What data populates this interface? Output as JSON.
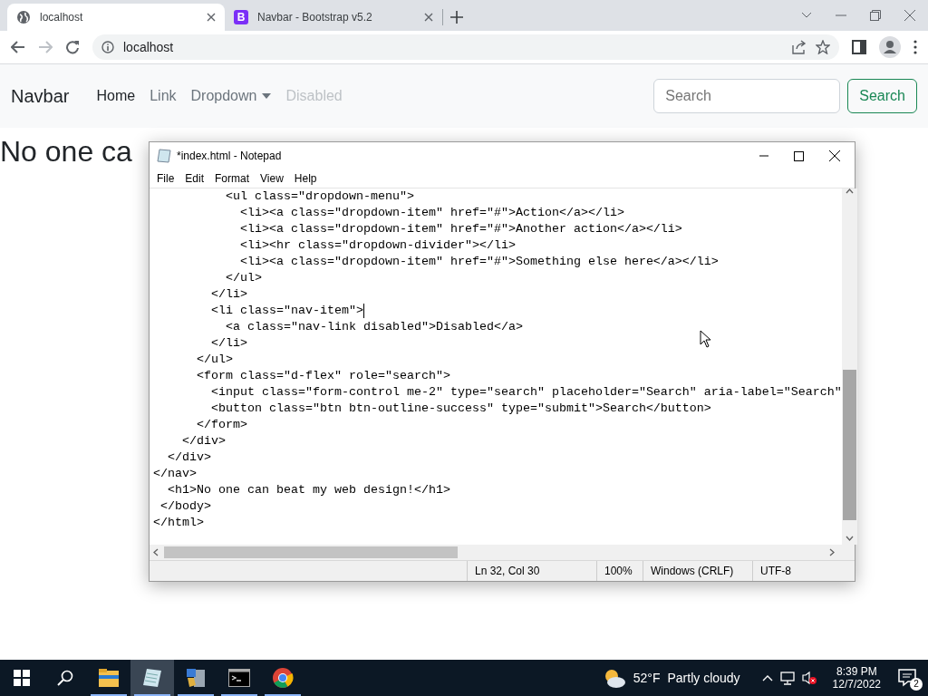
{
  "browser": {
    "tabs": [
      {
        "kind": "globe",
        "title": "localhost",
        "selected": true
      },
      {
        "kind": "logo",
        "logo_text": "B",
        "title": "Navbar - Bootstrap v5.2",
        "selected": false
      }
    ],
    "address": "localhost"
  },
  "page": {
    "navbar": {
      "brand": "Navbar",
      "links": [
        {
          "label": "Home",
          "kind": "link",
          "selected": true,
          "disabled": false
        },
        {
          "label": "Link",
          "kind": "link",
          "selected": false,
          "disabled": false
        },
        {
          "label": "Dropdown",
          "kind": "dropdown",
          "selected": false,
          "disabled": false
        },
        {
          "label": "Disabled",
          "kind": "link",
          "selected": false,
          "disabled": true
        }
      ],
      "search": {
        "placeholder": "Search"
      },
      "search_button": "Search"
    },
    "heading": "No one ca"
  },
  "notepad": {
    "title": "*index.html - Notepad",
    "menu": [
      "File",
      "Edit",
      "Format",
      "View",
      "Help"
    ],
    "lines": [
      {
        "text": "          <ul class=\"dropdown-menu\">",
        "caret": false
      },
      {
        "text": "            <li><a class=\"dropdown-item\" href=\"#\">Action</a></li>",
        "caret": false
      },
      {
        "text": "            <li><a class=\"dropdown-item\" href=\"#\">Another action</a></li>",
        "caret": false
      },
      {
        "text": "            <li><hr class=\"dropdown-divider\"></li>",
        "caret": false
      },
      {
        "text": "            <li><a class=\"dropdown-item\" href=\"#\">Something else here</a></li>",
        "caret": false
      },
      {
        "text": "          </ul>",
        "caret": false
      },
      {
        "text": "        </li>",
        "caret": false
      },
      {
        "text": "        <li class=\"nav-item\">",
        "caret": true
      },
      {
        "text": "          <a class=\"nav-link disabled\">Disabled</a>",
        "caret": false
      },
      {
        "text": "        </li>",
        "caret": false
      },
      {
        "text": "      </ul>",
        "caret": false
      },
      {
        "text": "      <form class=\"d-flex\" role=\"search\">",
        "caret": false
      },
      {
        "text": "        <input class=\"form-control me-2\" type=\"search\" placeholder=\"Search\" aria-label=\"Search\"",
        "caret": false
      },
      {
        "text": "        <button class=\"btn btn-outline-success\" type=\"submit\">Search</button>",
        "caret": false
      },
      {
        "text": "      </form>",
        "caret": false
      },
      {
        "text": "    </div>",
        "caret": false
      },
      {
        "text": "  </div>",
        "caret": false
      },
      {
        "text": "</nav>",
        "caret": false
      },
      {
        "text": "  <h1>No one can beat my web design!</h1>",
        "caret": false
      },
      {
        "text": " </body>",
        "caret": false
      },
      {
        "text": "</html>",
        "caret": false
      }
    ],
    "status": [
      "Ln 32, Col 30",
      "100%",
      "Windows (CRLF)",
      "UTF-8"
    ]
  },
  "taskbar": {
    "apps": [
      {
        "kind": "explorer",
        "selected": false
      },
      {
        "kind": "notepad",
        "selected": true
      },
      {
        "kind": "installer",
        "selected": false
      },
      {
        "kind": "terminal",
        "selected": false
      },
      {
        "kind": "chrome",
        "selected": false
      }
    ],
    "weather": {
      "temperature": "52°F",
      "condition": "Partly cloudy"
    },
    "time": "8:39 PM",
    "date": "12/7/2022",
    "notifications": "2"
  }
}
